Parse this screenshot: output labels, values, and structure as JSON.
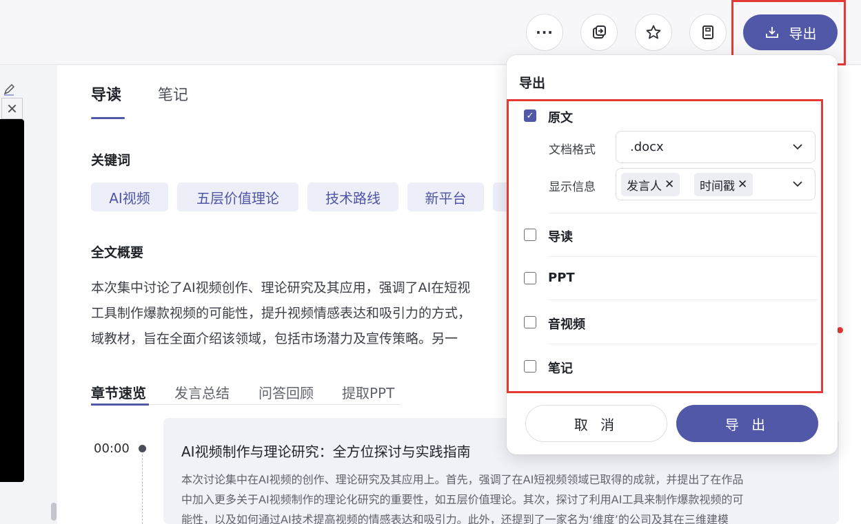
{
  "toolbar": {
    "more": "···",
    "export_label": "导出"
  },
  "tabs": [
    {
      "label": "导读",
      "active": true
    },
    {
      "label": "笔记",
      "active": false
    }
  ],
  "keywords": {
    "title": "关键词",
    "items": [
      "AI视频",
      "五层价值理论",
      "技术路线",
      "新平台"
    ]
  },
  "summary": {
    "title": "全文概要",
    "lines": [
      "本次集中讨论了AI视频创作、理论研究及其应用，强调了AI在短视",
      "工具制作爆款视频的可能性，提升视频情感表达和吸引力的方式，",
      "域教材，旨在全面介绍该领域，包括市场潜力及宣传策略。另一"
    ]
  },
  "subtabs": [
    "章节速览",
    "发言总结",
    "问答回顾",
    "提取PPT"
  ],
  "chapter": {
    "time": "00:00",
    "title": "AI视频制作与理论研究：全方位探讨与实践指南",
    "lines": [
      "本次讨论集中在AI视频的创作、理论研究及其应用上。首先，强调了在AI短视频领域已取得的成就，并提出了在作品",
      "中加入更多关于AI视频制作的理论化研究的重要性，如五层价值理论。其次，探讨了利用AI工具来制作爆款视频的可",
      "能性，以及如何通过AI技术提高视频的情感表达和吸引力。此外，还提到了一家名为‘维度’的公司及其在三维建模"
    ]
  },
  "export_panel": {
    "title": "导出",
    "original": {
      "label": "原文",
      "checked": true,
      "format_label": "文档格式",
      "format_value": ".docx",
      "display_label": "显示信息",
      "display_tags": [
        "发言人",
        "时间戳"
      ]
    },
    "options": [
      {
        "label": "导读",
        "checked": false
      },
      {
        "label": "PPT",
        "checked": false
      },
      {
        "label": "音视频",
        "checked": false
      },
      {
        "label": "笔记",
        "checked": false
      }
    ],
    "cancel_label": "取 消",
    "confirm_label": "导 出"
  },
  "colors": {
    "accent": "#5258a8",
    "chip_bg": "#eceef8",
    "highlight": "#e53935"
  }
}
